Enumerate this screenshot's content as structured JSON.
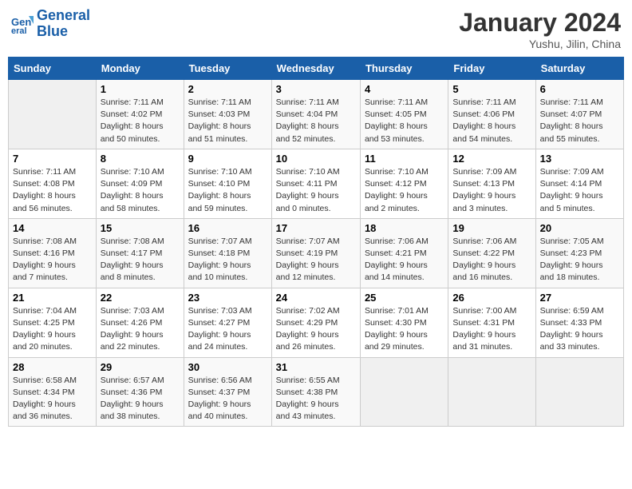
{
  "header": {
    "logo_line1": "General",
    "logo_line2": "Blue",
    "month": "January 2024",
    "location": "Yushu, Jilin, China"
  },
  "days_of_week": [
    "Sunday",
    "Monday",
    "Tuesday",
    "Wednesday",
    "Thursday",
    "Friday",
    "Saturday"
  ],
  "weeks": [
    [
      {
        "day": "",
        "info": ""
      },
      {
        "day": "1",
        "info": "Sunrise: 7:11 AM\nSunset: 4:02 PM\nDaylight: 8 hours\nand 50 minutes."
      },
      {
        "day": "2",
        "info": "Sunrise: 7:11 AM\nSunset: 4:03 PM\nDaylight: 8 hours\nand 51 minutes."
      },
      {
        "day": "3",
        "info": "Sunrise: 7:11 AM\nSunset: 4:04 PM\nDaylight: 8 hours\nand 52 minutes."
      },
      {
        "day": "4",
        "info": "Sunrise: 7:11 AM\nSunset: 4:05 PM\nDaylight: 8 hours\nand 53 minutes."
      },
      {
        "day": "5",
        "info": "Sunrise: 7:11 AM\nSunset: 4:06 PM\nDaylight: 8 hours\nand 54 minutes."
      },
      {
        "day": "6",
        "info": "Sunrise: 7:11 AM\nSunset: 4:07 PM\nDaylight: 8 hours\nand 55 minutes."
      }
    ],
    [
      {
        "day": "7",
        "info": "Sunrise: 7:11 AM\nSunset: 4:08 PM\nDaylight: 8 hours\nand 56 minutes."
      },
      {
        "day": "8",
        "info": "Sunrise: 7:10 AM\nSunset: 4:09 PM\nDaylight: 8 hours\nand 58 minutes."
      },
      {
        "day": "9",
        "info": "Sunrise: 7:10 AM\nSunset: 4:10 PM\nDaylight: 8 hours\nand 59 minutes."
      },
      {
        "day": "10",
        "info": "Sunrise: 7:10 AM\nSunset: 4:11 PM\nDaylight: 9 hours\nand 0 minutes."
      },
      {
        "day": "11",
        "info": "Sunrise: 7:10 AM\nSunset: 4:12 PM\nDaylight: 9 hours\nand 2 minutes."
      },
      {
        "day": "12",
        "info": "Sunrise: 7:09 AM\nSunset: 4:13 PM\nDaylight: 9 hours\nand 3 minutes."
      },
      {
        "day": "13",
        "info": "Sunrise: 7:09 AM\nSunset: 4:14 PM\nDaylight: 9 hours\nand 5 minutes."
      }
    ],
    [
      {
        "day": "14",
        "info": "Sunrise: 7:08 AM\nSunset: 4:16 PM\nDaylight: 9 hours\nand 7 minutes."
      },
      {
        "day": "15",
        "info": "Sunrise: 7:08 AM\nSunset: 4:17 PM\nDaylight: 9 hours\nand 8 minutes."
      },
      {
        "day": "16",
        "info": "Sunrise: 7:07 AM\nSunset: 4:18 PM\nDaylight: 9 hours\nand 10 minutes."
      },
      {
        "day": "17",
        "info": "Sunrise: 7:07 AM\nSunset: 4:19 PM\nDaylight: 9 hours\nand 12 minutes."
      },
      {
        "day": "18",
        "info": "Sunrise: 7:06 AM\nSunset: 4:21 PM\nDaylight: 9 hours\nand 14 minutes."
      },
      {
        "day": "19",
        "info": "Sunrise: 7:06 AM\nSunset: 4:22 PM\nDaylight: 9 hours\nand 16 minutes."
      },
      {
        "day": "20",
        "info": "Sunrise: 7:05 AM\nSunset: 4:23 PM\nDaylight: 9 hours\nand 18 minutes."
      }
    ],
    [
      {
        "day": "21",
        "info": "Sunrise: 7:04 AM\nSunset: 4:25 PM\nDaylight: 9 hours\nand 20 minutes."
      },
      {
        "day": "22",
        "info": "Sunrise: 7:03 AM\nSunset: 4:26 PM\nDaylight: 9 hours\nand 22 minutes."
      },
      {
        "day": "23",
        "info": "Sunrise: 7:03 AM\nSunset: 4:27 PM\nDaylight: 9 hours\nand 24 minutes."
      },
      {
        "day": "24",
        "info": "Sunrise: 7:02 AM\nSunset: 4:29 PM\nDaylight: 9 hours\nand 26 minutes."
      },
      {
        "day": "25",
        "info": "Sunrise: 7:01 AM\nSunset: 4:30 PM\nDaylight: 9 hours\nand 29 minutes."
      },
      {
        "day": "26",
        "info": "Sunrise: 7:00 AM\nSunset: 4:31 PM\nDaylight: 9 hours\nand 31 minutes."
      },
      {
        "day": "27",
        "info": "Sunrise: 6:59 AM\nSunset: 4:33 PM\nDaylight: 9 hours\nand 33 minutes."
      }
    ],
    [
      {
        "day": "28",
        "info": "Sunrise: 6:58 AM\nSunset: 4:34 PM\nDaylight: 9 hours\nand 36 minutes."
      },
      {
        "day": "29",
        "info": "Sunrise: 6:57 AM\nSunset: 4:36 PM\nDaylight: 9 hours\nand 38 minutes."
      },
      {
        "day": "30",
        "info": "Sunrise: 6:56 AM\nSunset: 4:37 PM\nDaylight: 9 hours\nand 40 minutes."
      },
      {
        "day": "31",
        "info": "Sunrise: 6:55 AM\nSunset: 4:38 PM\nDaylight: 9 hours\nand 43 minutes."
      },
      {
        "day": "",
        "info": ""
      },
      {
        "day": "",
        "info": ""
      },
      {
        "day": "",
        "info": ""
      }
    ]
  ]
}
